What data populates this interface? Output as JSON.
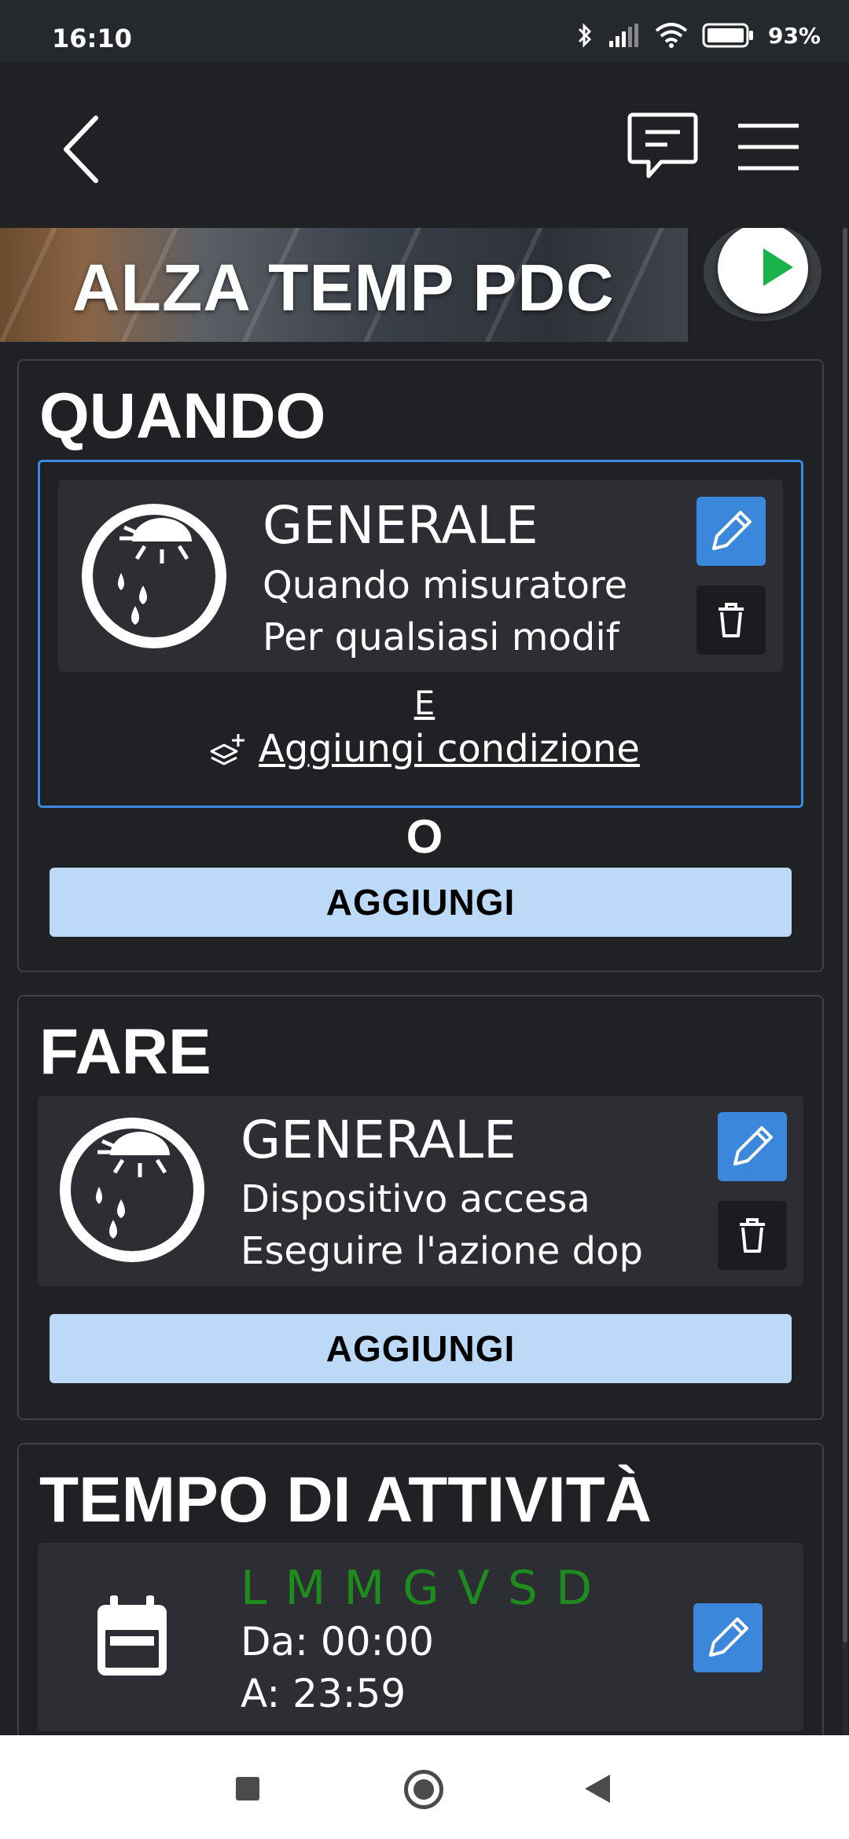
{
  "status_bar": {
    "time": "16:10",
    "battery": "93%"
  },
  "header": {
    "back_icon": "chevron-left-icon",
    "chat_icon": "chat-bubble-icon",
    "menu_icon": "hamburger-menu-icon"
  },
  "banner": {
    "title": "ALZA TEMP PDC",
    "play_icon": "play-icon"
  },
  "when_section": {
    "title": "QUANDO",
    "item": {
      "icon": "weather-sun-rain-icon",
      "title": "GENERALE",
      "line1": "Quando misuratore",
      "line2": "Per qualsiasi modif"
    },
    "and_label": "E",
    "add_condition_label": "Aggiungi condizione",
    "or_label": "O",
    "add_button": "AGGIUNGI"
  },
  "do_section": {
    "title": "FARE",
    "item": {
      "icon": "weather-sun-rain-icon",
      "title": "GENERALE",
      "line1": "Dispositivo accesa",
      "line2": "Eseguire l'azione dop"
    },
    "add_button": "AGGIUNGI"
  },
  "schedule_section": {
    "title": "TEMPO DI ATTIVITÀ",
    "days": "L M M G V S D",
    "from": "Da: 00:00",
    "to": "A: 23:59",
    "icon": "calendar-icon"
  },
  "colors": {
    "accent": "#3a87dc",
    "add_button_bg": "#bcdaf7",
    "days_active": "#1e8b1e",
    "background": "#202124"
  }
}
